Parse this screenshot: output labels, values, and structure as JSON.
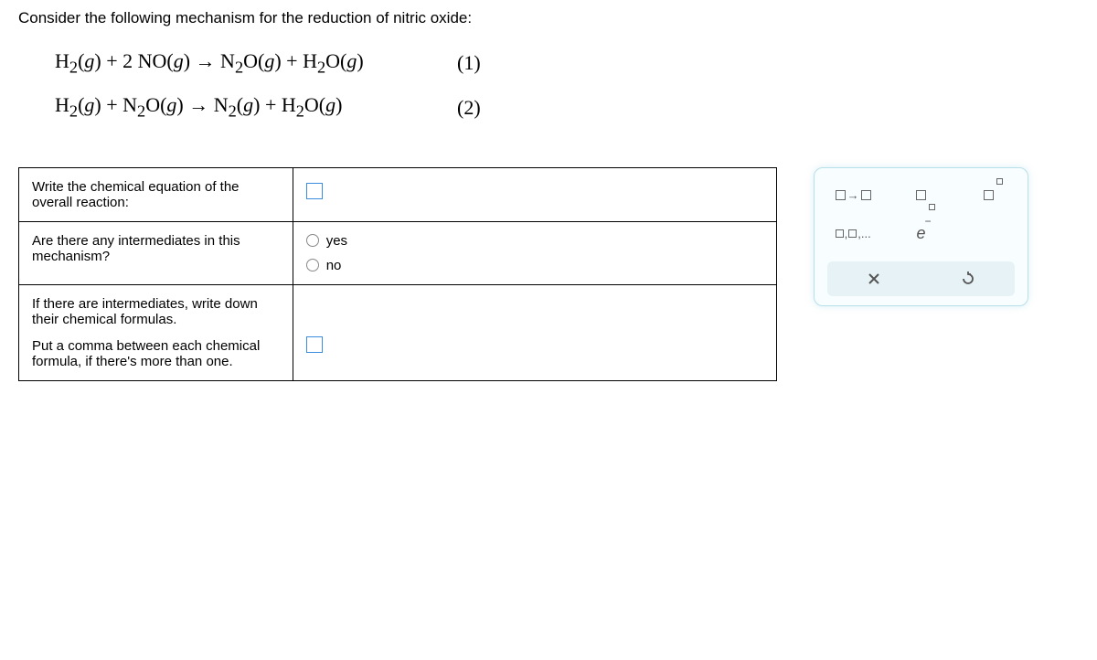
{
  "question": {
    "intro": "Consider the following mechanism for the reduction of nitric oxide:",
    "equations": [
      {
        "text": "H₂(g) + 2 NO(g) → N₂O(g) + H₂O(g)",
        "number": "(1)"
      },
      {
        "text": "H₂(g) + N₂O(g) → N₂(g) + H₂O(g)",
        "number": "(2)"
      }
    ]
  },
  "table": {
    "rows": [
      {
        "label": "Write the chemical equation of the overall reaction:"
      },
      {
        "label": "Are there any intermediates in this mechanism?",
        "radios": {
          "yes": "yes",
          "no": "no"
        }
      },
      {
        "label_line1": "If there are intermediates, write down their chemical formulas.",
        "label_line2": "Put a comma between each chemical formula, if there's more than one."
      }
    ]
  },
  "tools": {
    "arrow": "→",
    "list": "▢,▢,...",
    "electron": "e"
  }
}
